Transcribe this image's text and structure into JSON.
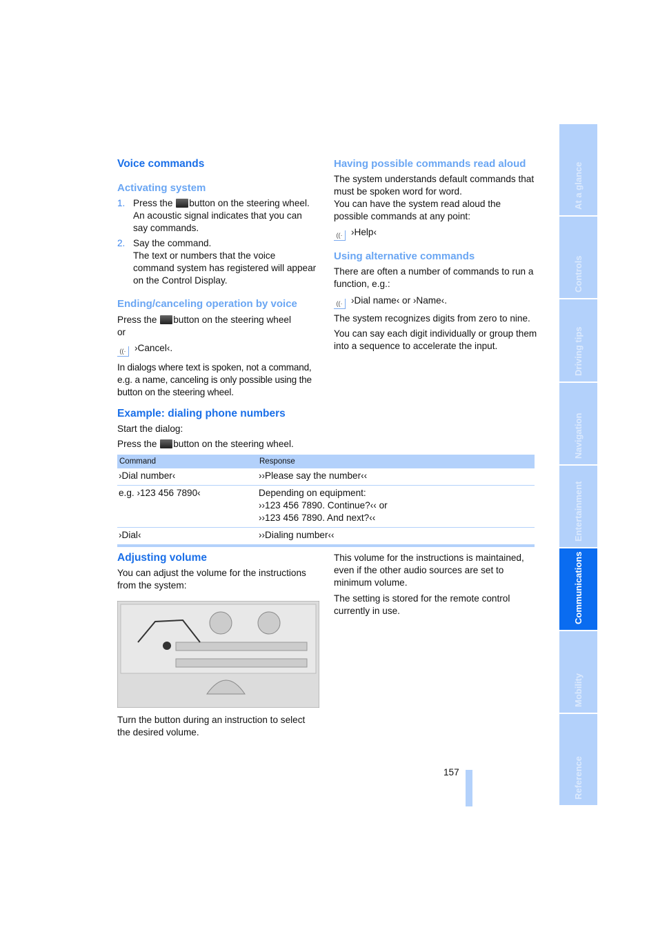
{
  "left": {
    "title": "Voice commands",
    "activating": {
      "heading": "Activating system",
      "steps": [
        {
          "num": "1.",
          "pre": "Press the",
          "post": "button on the steering wheel.",
          "detail": "An acoustic signal indicates that you can say commands."
        },
        {
          "num": "2.",
          "pre": "Say the command.",
          "detail": "The text or numbers that the voice command system has registered will appear on the Control Display."
        }
      ]
    },
    "ending": {
      "heading": "Ending/canceling operation by voice",
      "pre": "Press the",
      "post": "button on the steering wheel",
      "or": "or",
      "command": "›Cancel‹.",
      "note": "In dialogs where text is spoken, not a command, e.g. a name, canceling is only possible using the button on the steering wheel."
    },
    "example": {
      "heading": "Example: dialing phone numbers",
      "start": "Start the dialog:",
      "pre": "Press the",
      "post": "button on the steering wheel."
    },
    "volume": {
      "heading": "Adjusting volume",
      "text": "You can adjust the volume for the instructions from the system:",
      "caption": "Turn the button during an instruction to select the desired volume."
    }
  },
  "right": {
    "readaloud": {
      "heading": "Having possible commands read aloud",
      "text": "The system understands default commands that must be spoken word for word.",
      "text2": "You can have the system read aloud the possible commands at any point:",
      "command": "›Help‹"
    },
    "alternative": {
      "heading": "Using alternative commands",
      "text": "There are often a number of commands to run a function, e.g.:",
      "command": "›Dial name‹ or ›Name‹.",
      "text2": "The system recognizes digits from zero to nine.",
      "text3": "You can say each digit individually or group them into a sequence to accelerate the input."
    },
    "volume": {
      "text": "This volume for the instructions is maintained, even if the other audio sources are set to minimum volume.",
      "text2": "The setting is stored for the remote control currently in use."
    }
  },
  "table": {
    "headers": [
      "Command",
      "Response"
    ],
    "rows": [
      [
        "›Dial number‹",
        "››Please say the number‹‹"
      ],
      [
        "e.g. ›123 456 7890‹",
        "Depending on equipment:\n››123 456 7890. Continue?‹‹ or\n››123 456 7890. And next?‹‹"
      ],
      [
        "›Dial‹",
        "››Dialing number‹‹"
      ]
    ]
  },
  "page_number": "157",
  "tabs": [
    "At a glance",
    "Controls",
    "Driving tips",
    "Navigation",
    "Entertainment",
    "Communications",
    "Mobility",
    "Reference"
  ],
  "active_tab": "Communications",
  "colors": {
    "heading": "#1a6fe8",
    "subheading": "#6aa6f3",
    "tab": "#b3d1fb",
    "tab_active": "#0a6cf0"
  }
}
